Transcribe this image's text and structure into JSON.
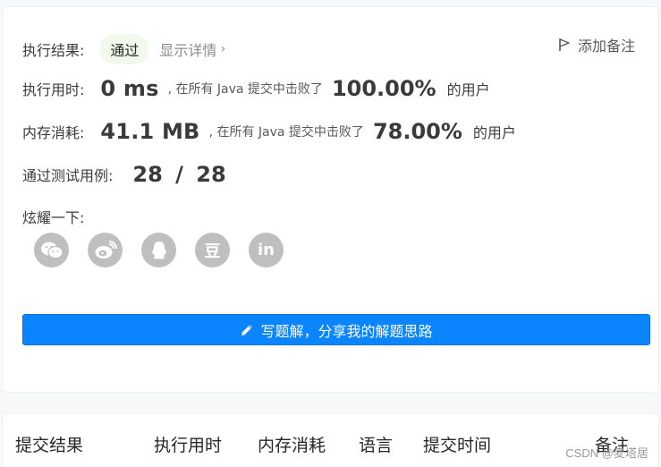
{
  "result": {
    "label": "执行结果:",
    "status": "通过",
    "details_link": "显示详情",
    "add_note": "添加备注"
  },
  "runtime": {
    "label": "执行用时:",
    "value": "0 ms",
    "beat_text": ", 在所有 Java 提交中击败了",
    "percent": "100.00%",
    "users": "的用户"
  },
  "memory": {
    "label": "内存消耗:",
    "value": "41.1 MB",
    "beat_text": ", 在所有 Java 提交中击败了",
    "percent": "78.00%",
    "users": "的用户"
  },
  "tests": {
    "label": "通过测试用例:",
    "value": "28 / 28"
  },
  "share": {
    "label": "炫耀一下:",
    "icons": [
      "wechat-icon",
      "weibo-icon",
      "qq-icon",
      "douban-icon",
      "linkedin-icon"
    ],
    "douban_glyph": "豆",
    "linkedin_glyph": "in"
  },
  "cta": {
    "label": "写题解，分享我的解题思路"
  },
  "table": {
    "headers": [
      "提交结果",
      "执行用时",
      "内存消耗",
      "语言",
      "提交时间",
      "备注"
    ]
  },
  "watermark": "CSDN @麦塔居",
  "colors": {
    "primary": "#0a84ff",
    "success_bg": "#f0f9ec",
    "icon_gray": "#bfbfbf"
  }
}
